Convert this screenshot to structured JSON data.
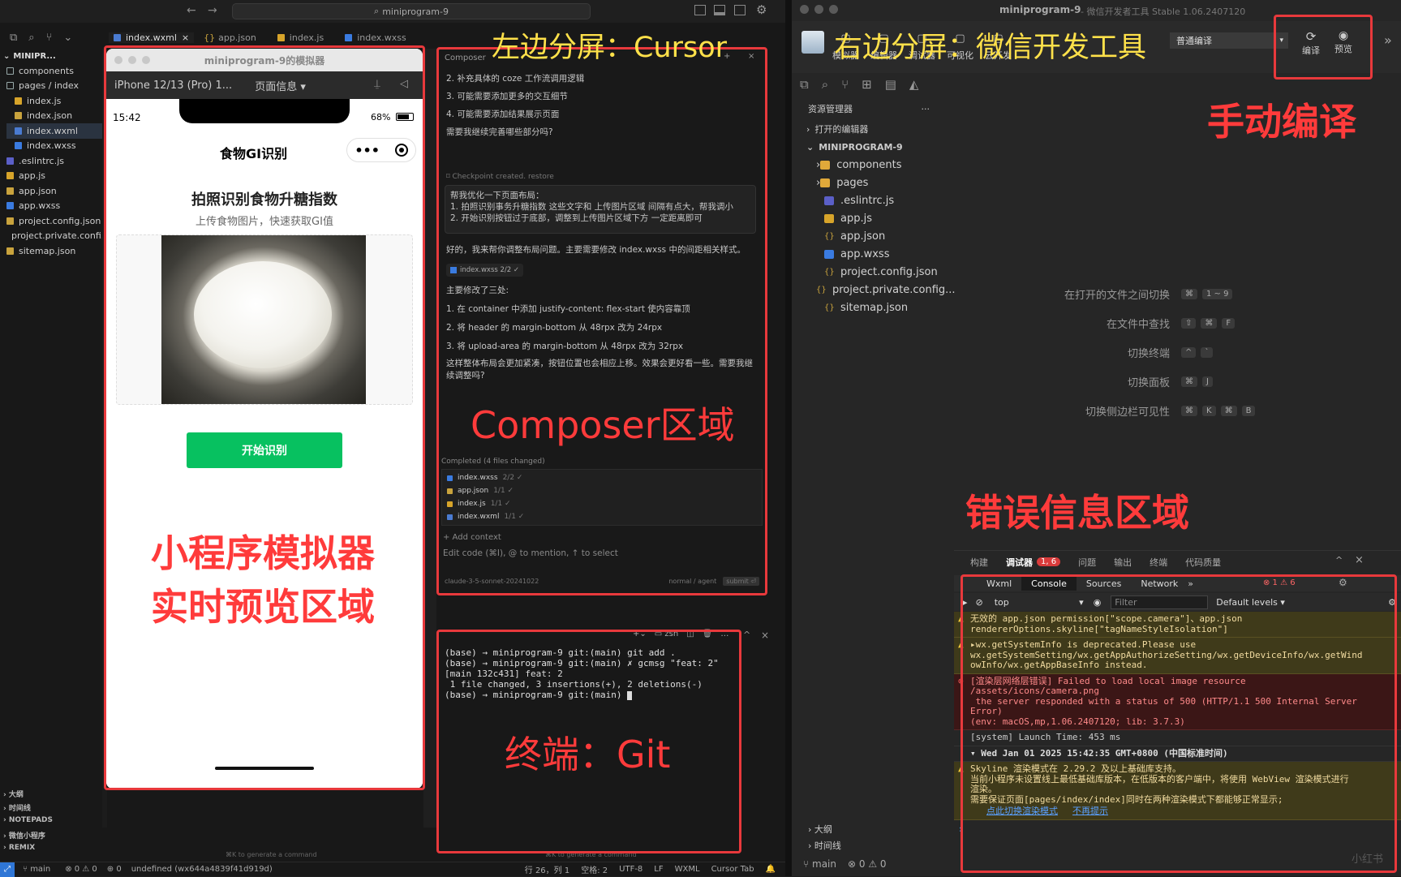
{
  "left": {
    "nav_title": "miniprogram-9",
    "tabs": [
      "index.wxml",
      "app.json",
      "index.js",
      "index.wxss"
    ],
    "explorer": {
      "root": "MINIPR...",
      "items": [
        {
          "label": "components",
          "kind": "folder"
        },
        {
          "label": "pages / index",
          "kind": "folder"
        },
        {
          "label": "index.js",
          "kind": "js"
        },
        {
          "label": "index.json",
          "kind": "json"
        },
        {
          "label": "index.wxml",
          "kind": "wxml"
        },
        {
          "label": "index.wxss",
          "kind": "wxss"
        },
        {
          "label": ".eslintrc.js",
          "kind": "eslint"
        },
        {
          "label": "app.js",
          "kind": "js"
        },
        {
          "label": "app.json",
          "kind": "json"
        },
        {
          "label": "app.wxss",
          "kind": "wxss"
        },
        {
          "label": "project.config.json",
          "kind": "json"
        },
        {
          "label": "project.private.confi...",
          "kind": "json"
        },
        {
          "label": "sitemap.json",
          "kind": "json"
        }
      ],
      "bottom_sections": [
        "大纲",
        "时间线",
        "NOTEPADS",
        "微信小程序",
        "REMIX"
      ]
    },
    "simulator": {
      "window_title": "miniprogram-9的模拟器",
      "device": "iPhone 12/13 (Pro) 1...",
      "page_info": "页面信息 ▾",
      "time": "15:42",
      "battery": "68%",
      "app_title": "食物GI识别",
      "heading": "拍照识别食物升糖指数",
      "subheading": "上传食物图片，快速获取GI值",
      "button": "开始识别"
    },
    "composer": {
      "header": "Composer",
      "lines": [
        "2. 补充具体的 coze 工作流调用逻辑",
        "3. 可能需要添加更多的交互细节",
        "4. 可能需要添加结果展示页面",
        "需要我继续完善哪些部分吗?"
      ],
      "checkpoint": "Checkpoint created. restore",
      "user_msg_title": "帮我优化一下页面布局：",
      "user_msg_1": "1. 拍照识别事务升糖指数 这些文字和 上传图片区域 间隔有点大，帮我调小",
      "user_msg_2": "2. 开始识别按钮过于底部，调整到上传图片区域下方 一定距离即可",
      "reply": "好的，我来帮你调整布局问题。主要需要修改 index.wxss 中的间距相关样式。",
      "file_chip": "index.wxss 2/2 ✓",
      "changes_title": "主要修改了三处:",
      "changes": [
        "1. 在 container 中添加 justify-content: flex-start 使内容靠顶",
        "2. 将 header 的 margin-bottom 从 48rpx 改为 24rpx",
        "3. 将 upload-area 的 margin-bottom 从 48rpx 改为 32rpx"
      ],
      "closing": "这样整体布局会更加紧凑，按钮位置也会相应上移。效果会更好看一些。需要我继续调整吗?",
      "completed": "Completed (4 files changed)",
      "files": [
        {
          "name": "index.wxss",
          "count": "2/2 ✓"
        },
        {
          "name": "app.json",
          "count": "1/1 ✓"
        },
        {
          "name": "index.js",
          "count": "1/1 ✓"
        },
        {
          "name": "index.wxml",
          "count": "1/1 ✓"
        }
      ],
      "add_context": "+ Add context",
      "input_placeholder": "Edit code (⌘I), @ to mention, ↑ to select",
      "model": "claude-3-5-sonnet-20241022",
      "mode": "normal / agent",
      "submit": "submit ⏎"
    },
    "terminal": {
      "shell": "zsh",
      "lines": [
        "(base) → miniprogram-9 git:(main) git add .",
        "(base) → miniprogram-9 git:(main) ✗ gcmsg \"feat: 2\"",
        "[main 132c431] feat: 2",
        " 1 file changed, 3 insertions(+), 2 deletions(-)",
        "(base) → miniprogram-9 git:(main) "
      ]
    },
    "statusbar": {
      "branch": "main",
      "errors": "⊗ 0 ⚠ 0",
      "ports": "⊕ 0",
      "app": "undefined (wx644a4839f41d919d)",
      "position": "行 26，列 1",
      "spaces": "空格: 2",
      "encoding": "UTF-8",
      "eol": "LF",
      "lang": "WXML",
      "tab": "Cursor Tab",
      "generate_hint": "⌘K to generate a command"
    }
  },
  "right": {
    "window_title": "miniprogram-9",
    "window_subtitle": "- 微信开发者工具 Stable 1.06.2407120",
    "toolbar": [
      "模拟器",
      "编辑器",
      "调试器",
      "可视化",
      "云开发"
    ],
    "compile_mode": "普通编译",
    "compile": "编译",
    "preview": "预览",
    "explorer_title": "资源管理器",
    "open_editors": "打开的编辑器",
    "project": "MINIPROGRAM-9",
    "files": [
      {
        "label": "components",
        "kind": "folder"
      },
      {
        "label": "pages",
        "kind": "folder"
      },
      {
        "label": ".eslintrc.js",
        "kind": "eslint"
      },
      {
        "label": "app.js",
        "kind": "js"
      },
      {
        "label": "app.json",
        "kind": "json"
      },
      {
        "label": "app.wxss",
        "kind": "wxss"
      },
      {
        "label": "project.config.json",
        "kind": "json"
      },
      {
        "label": "project.private.config...",
        "kind": "json"
      },
      {
        "label": "sitemap.json",
        "kind": "json"
      }
    ],
    "shortcuts": [
      {
        "label": "在打开的文件之间切换",
        "keys": [
          "⌘",
          "1 ~ 9"
        ]
      },
      {
        "label": "在文件中查找",
        "keys": [
          "⇧",
          "⌘",
          "F"
        ]
      },
      {
        "label": "切换终端",
        "keys": [
          "^",
          "`"
        ]
      },
      {
        "label": "切换面板",
        "keys": [
          "⌘",
          "J"
        ]
      },
      {
        "label": "切换侧边栏可见性",
        "keys": [
          "⌘",
          "K",
          "⌘",
          "B"
        ]
      }
    ],
    "bottom_tabs": [
      "构建",
      "调试器",
      "问题",
      "输出",
      "终端",
      "代码质量"
    ],
    "debug_badge": "1, 6",
    "devtools_tabs": [
      "Wxml",
      "Console",
      "Sources",
      "Network"
    ],
    "devtools_counts": "⊗ 1 ⚠ 6",
    "context": "top",
    "filter": "Filter",
    "levels": "Default levels ▾",
    "console": [
      {
        "type": "warn",
        "text": "无效的 app.json permission[\"scope.camera\"]、app.json\nrendererOptions.skyline[\"tagNameStyleIsolation\"]"
      },
      {
        "type": "warn",
        "text": "▸wx.getSystemInfo is deprecated.Please use\nwx.getSystemSetting/wx.getAppAuthorizeSetting/wx.getDeviceInfo/wx.getWind\nowInfo/wx.getAppBaseInfo instead."
      },
      {
        "type": "error",
        "text": "[渲染层网络层错误] Failed to load local image resource\n/assets/icons/camera.png\n the server responded with a status of 500 (HTTP/1.1 500 Internal Server\nError)\n(env: macOS,mp,1.06.2407120; lib: 3.7.3)"
      },
      {
        "type": "info",
        "text": "[system] Launch Time: 453 ms"
      },
      {
        "type": "group",
        "text": "▾ Wed Jan 01 2025 15:42:35 GMT+0800 (中国标准时间)"
      },
      {
        "type": "warn",
        "text": "Skyline 渲染模式在 2.29.2 及以上基础库支持。\n当前小程序未设置线上最低基础库版本，在低版本的客户端中，将使用 WebView 渲染模式进行\n渲染。\n需要保证页面[pages/index/index]同时在两种渲染模式下都能够正常显示;"
      }
    ],
    "console_links": [
      "点此切换渲染模式",
      "不再提示"
    ],
    "sidebar_bottom": [
      "大纲",
      "时间线"
    ],
    "status": {
      "branch": "main",
      "errors": "⊗ 0 ⚠ 0"
    }
  },
  "annotations": {
    "left_split": "左边分屏：Cursor",
    "right_split": "右边分屏：微信开发工具",
    "composer_area": "Composer区域",
    "simulator_area_1": "小程序模拟器",
    "simulator_area_2": "实时预览区域",
    "terminal_area": "终端：Git",
    "manual_compile": "手动编译",
    "error_area": "错误信息区域"
  },
  "watermark": "小红书",
  "colors": {
    "annotation_red": "#e8393c",
    "annotation_yellow": "#ffe14a",
    "wechat_green": "#07c160"
  }
}
